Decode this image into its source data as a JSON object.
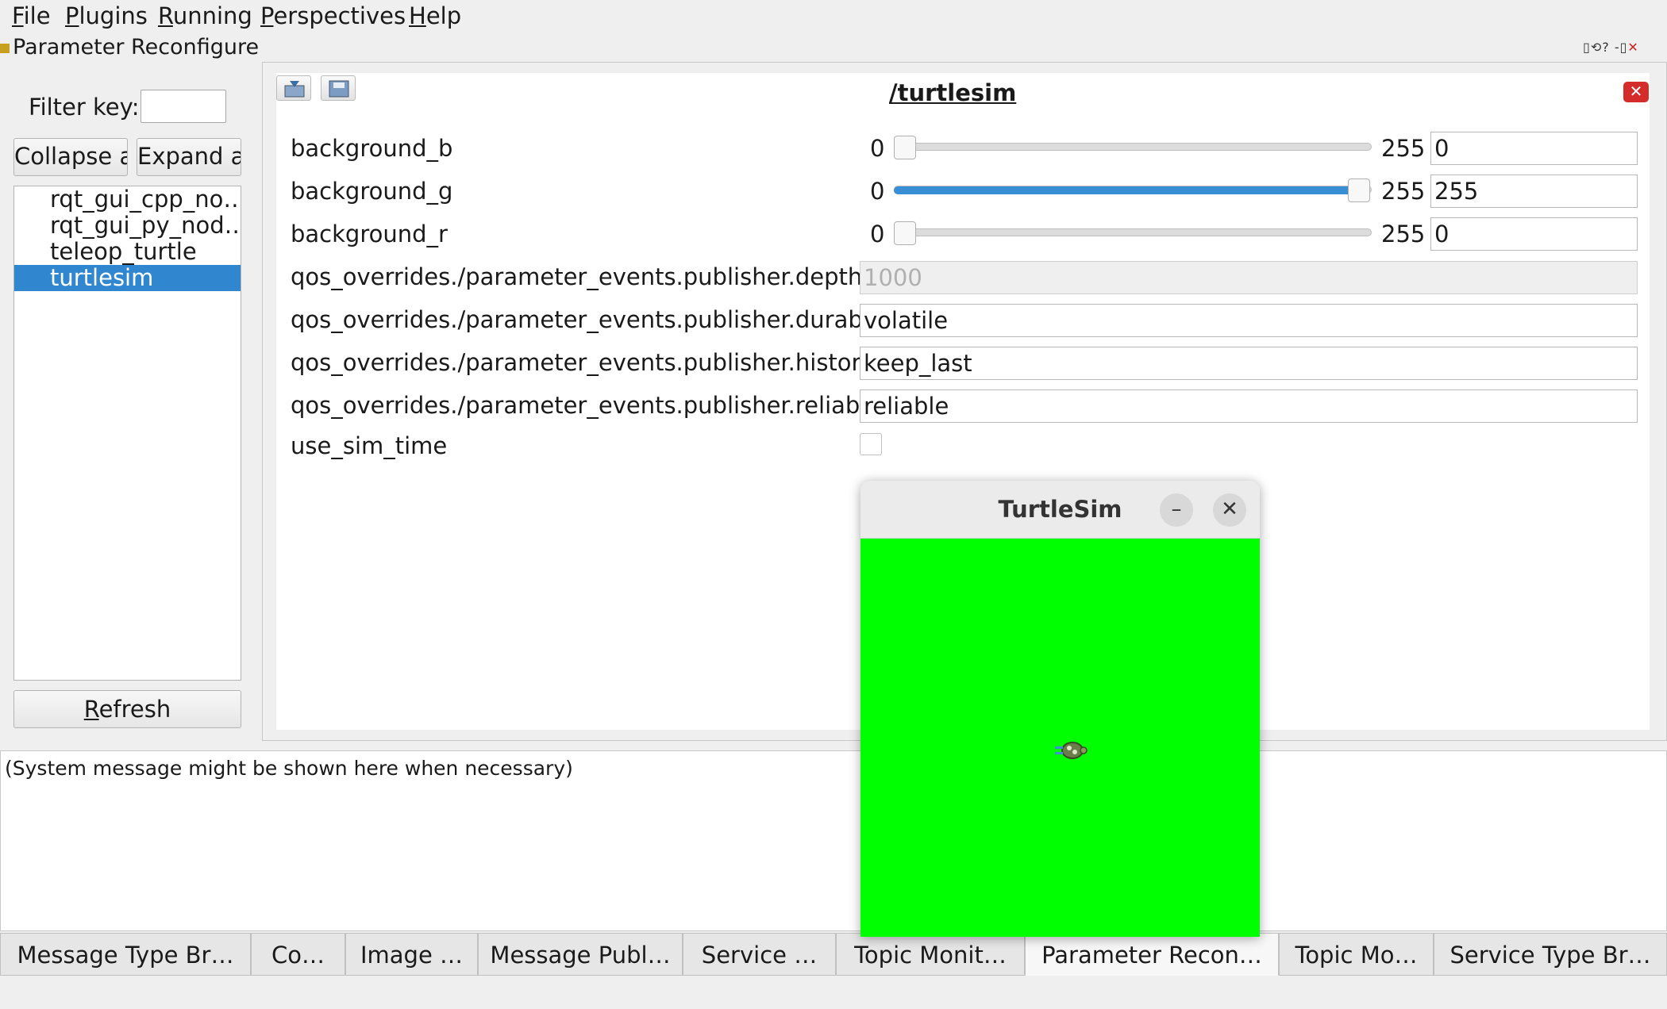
{
  "menu": [
    {
      "first": "F",
      "rest": "ile"
    },
    {
      "first": "P",
      "rest": "lugins"
    },
    {
      "first": "R",
      "rest": "unning"
    },
    {
      "first": "P",
      "rest": "erspectives"
    },
    {
      "first": "H",
      "rest": "elp"
    }
  ],
  "plugin": {
    "title": "Parameter Reconfigure",
    "filter_label": "Filter key:",
    "filter_value": "",
    "collapse_all": "Collapse all",
    "expand_all": "Expand all",
    "refresh": "Refresh",
    "nodes": [
      "rqt_gui_cpp_no…",
      "rqt_gui_py_nod…",
      "teleop_turtle",
      "turtlesim"
    ],
    "selected_node": "turtlesim"
  },
  "editor": {
    "node_name": "/turtlesim",
    "params": {
      "background_b": {
        "label": "background_b",
        "min": "0",
        "max": "255",
        "value": "0"
      },
      "background_g": {
        "label": "background_g",
        "min": "0",
        "max": "255",
        "value": "255"
      },
      "background_r": {
        "label": "background_r",
        "min": "0",
        "max": "255",
        "value": "0"
      },
      "depth": {
        "label": "qos_overrides./parameter_events.publisher.depth",
        "value": "1000"
      },
      "durability": {
        "label": "qos_overrides./parameter_events.publisher.durability",
        "value": "volatile"
      },
      "history": {
        "label": "qos_overrides./parameter_events.publisher.history",
        "value": "keep_last"
      },
      "reliability": {
        "label": "qos_overrides./parameter_events.publisher.reliability",
        "value": "reliable"
      },
      "use_sim_time": {
        "label": "use_sim_time",
        "checked": false
      }
    }
  },
  "system_message": "(System message might be shown here when necessary)",
  "tabs": [
    "Message Type Br…",
    "Co…",
    "Image …",
    "Message Publ…",
    "Service …",
    "Topic Monit…",
    "Parameter Recon…",
    "Topic Mo…",
    "Service Type Br…"
  ],
  "active_tab": "Parameter Recon…",
  "turtlesim_window": {
    "title": "TurtleSim",
    "minimize": "–",
    "close": "✕",
    "background_color": "#00ff00"
  },
  "icons": [
    "load-icon",
    "save-icon",
    "close-icon",
    "turtle-icon"
  ]
}
